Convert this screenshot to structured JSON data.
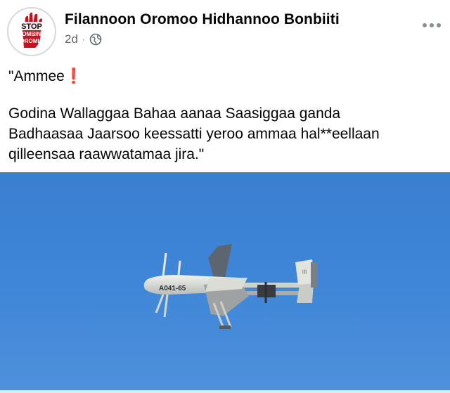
{
  "post": {
    "author": "Filannoon Oromoo Hidhannoo Bonbiiti",
    "time": "2d",
    "separator": "·",
    "privacy_icon": "globe-icon",
    "more_icon": "more-options-icon",
    "avatar": {
      "text_top": "STOP",
      "text_middle": "BOMBING",
      "text_bottom": "OROMIA",
      "icon": "raised-hand-icon"
    },
    "text_line1": "\"Ammee",
    "text_emoji": "❗",
    "text_line2": "Godina Wallaggaa Bahaa aanaa Saasiggaa ganda",
    "text_line3": "Badhaasaa Jaarsoo keessatti yeroo ammaa hal**eellaan",
    "text_line4": "qilleensaa raawwatamaa jira.\""
  },
  "photo": {
    "drone_marking": "A041-65",
    "sky_color": "#3f85d6",
    "drone_color": "#e9e9e4"
  },
  "colors": {
    "text": "#050505",
    "meta": "#65676b",
    "accent_red": "#e0213a"
  }
}
